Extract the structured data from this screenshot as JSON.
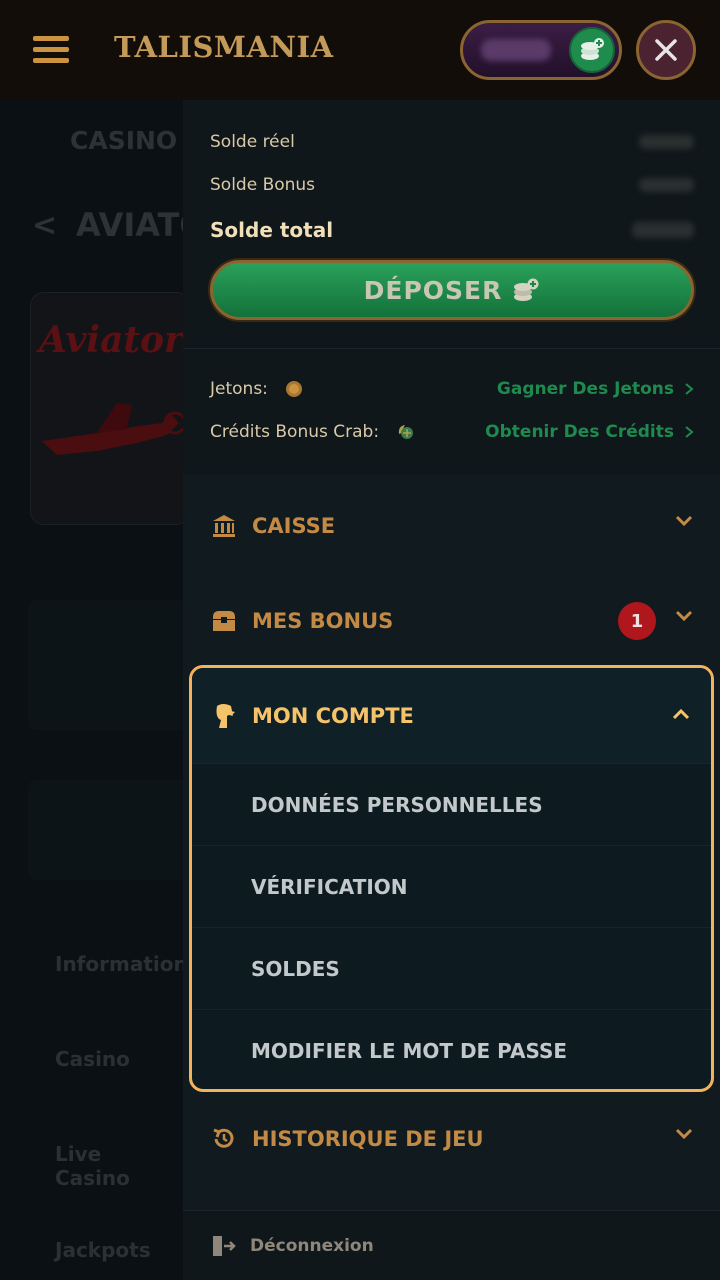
{
  "header": {
    "logo": "TALISMANIA"
  },
  "background": {
    "section": "CASINO",
    "back_glyph": "<",
    "game_title": "AVIATO",
    "game_card_title": "Aviator",
    "links": [
      "Informations",
      "Casino",
      "Live Casino",
      "Jackpots"
    ]
  },
  "balance": {
    "real_label": "Solde réel",
    "bonus_label": "Solde Bonus",
    "total_label": "Solde total"
  },
  "deposit": {
    "label": "DÉPOSER"
  },
  "tokens": {
    "jetons_label": "Jetons:",
    "jetons_link": "Gagner Des Jetons",
    "crab_label": "Crédits Bonus Crab:",
    "crab_link": "Obtenir Des Crédits"
  },
  "menu": {
    "caisse": "CAISSE",
    "bonus": "MES BONUS",
    "bonus_badge": "1",
    "account": "MON COMPTE",
    "account_items": [
      "DONNÉES PERSONNELLES",
      "VÉRIFICATION",
      "SOLDES",
      "MODIFIER LE MOT DE PASSE"
    ],
    "history": "HISTORIQUE DE JEU",
    "logout": "Déconnexion"
  },
  "colors": {
    "accent_gold": "#c28a45",
    "highlight": "#f2b35c",
    "green": "#1e8a4e",
    "badge_red": "#b0171c"
  }
}
